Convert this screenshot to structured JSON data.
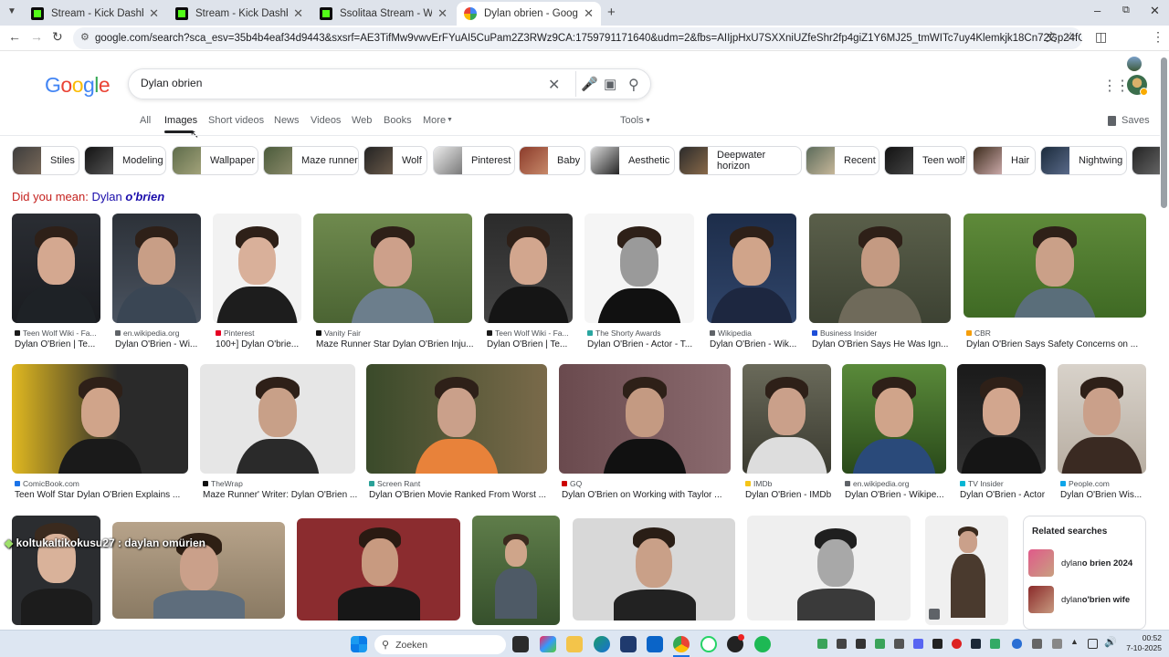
{
  "tabs": [
    {
      "title": "Stream - Kick Dashboard",
      "icon": "kick-icon"
    },
    {
      "title": "Stream - Kick Dashboard",
      "icon": "kick-icon"
    },
    {
      "title": "Ssolitaa Stream - Watch Live on",
      "icon": "kick-icon"
    },
    {
      "title": "Dylan obrien - Google Search",
      "icon": "google-icon"
    }
  ],
  "address_bar": {
    "url": "google.com/search?sca_esv=35b4b4eaf34d9443&sxsrf=AE3TifMw9vwvErFYuAI5CuPam2Z3RWz9CA:1759791171640&udm=2&fbs=AIIjpHxU7SXXniUZfeShr2fp4giZ1Y6MJ25_tmWITc7uy4Klemkjk18Cn72Gp24fGkjjh6w0Scodj_KwyDDcIrPkvfwX0qqWL2S..."
  },
  "search": {
    "query": "Dylan obrien"
  },
  "nav_tabs": [
    "All",
    "Images",
    "Short videos",
    "News",
    "Videos",
    "Web",
    "Books",
    "More"
  ],
  "tools_label": "Tools",
  "saves_label": "Saves",
  "chips": [
    "Stiles",
    "Modeling",
    "Wallpaper",
    "Maze runner",
    "Wolf",
    "Pinterest",
    "Baby",
    "Aesthetic",
    "Deepwater horizon",
    "Recent",
    "Teen wolf",
    "Hair",
    "Nightwing"
  ],
  "did_you_mean": {
    "prefix": "Did you mean:",
    "plain": "Dylan",
    "emph": "o'brien"
  },
  "results_row1": [
    {
      "source": "Teen Wolf Wiki - Fa...",
      "caption": "Dylan O'Brien | Te..."
    },
    {
      "source": "en.wikipedia.org",
      "caption": "Dylan O'Brien - Wi..."
    },
    {
      "source": "Pinterest",
      "caption": "100+] Dylan O'brie..."
    },
    {
      "source": "Vanity Fair",
      "caption": "Maze Runner Star Dylan O'Brien Inju..."
    },
    {
      "source": "Teen Wolf Wiki - Fa...",
      "caption": "Dylan O'Brien | Te..."
    },
    {
      "source": "The Shorty Awards",
      "caption": "Dylan O'Brien - Actor - T..."
    },
    {
      "source": "Wikipedia",
      "caption": "Dylan O'Brien - Wik..."
    },
    {
      "source": "Business Insider",
      "caption": "Dylan O'Brien Says He Was Ign..."
    },
    {
      "source": "CBR",
      "caption": "Dylan O'Brien Says Safety Concerns on ..."
    }
  ],
  "results_row2": [
    {
      "source": "ComicBook.com",
      "caption": "Teen Wolf Star Dylan O'Brien Explains ..."
    },
    {
      "source": "TheWrap",
      "caption": "Maze Runner' Writer: Dylan O'Brien ..."
    },
    {
      "source": "Screen Rant",
      "caption": "Dylan O'Brien Movie Ranked From Worst ..."
    },
    {
      "source": "GQ",
      "caption": "Dylan O'Brien on Working with Taylor ..."
    },
    {
      "source": "IMDb",
      "caption": "Dylan O'Brien - IMDb"
    },
    {
      "source": "en.wikipedia.org",
      "caption": "Dylan O'Brien - Wikipe..."
    },
    {
      "source": "TV Insider",
      "caption": "Dylan O'Brien - Actor"
    },
    {
      "source": "People.com",
      "caption": "Dylan O'Brien Wis..."
    }
  ],
  "related": {
    "title": "Related searches",
    "items": [
      {
        "plain": "dylan ",
        "bold": "o brien 2024"
      },
      {
        "plain": "dylan ",
        "bold": "o'brien wife"
      }
    ]
  },
  "overlay": {
    "user": "koltukaltikokusu27",
    "sep": " : ",
    "message": "daylan omürien"
  },
  "taskbar": {
    "search_placeholder": "Zoeken",
    "time": "00:52",
    "date": "7-10-2025"
  },
  "colors": {
    "google_blue": "#4285f4",
    "google_red": "#ea4335",
    "google_yellow": "#fbbc05",
    "google_green": "#34a853",
    "link": "#1a0dab",
    "did_you_mean": "#c5221f"
  }
}
